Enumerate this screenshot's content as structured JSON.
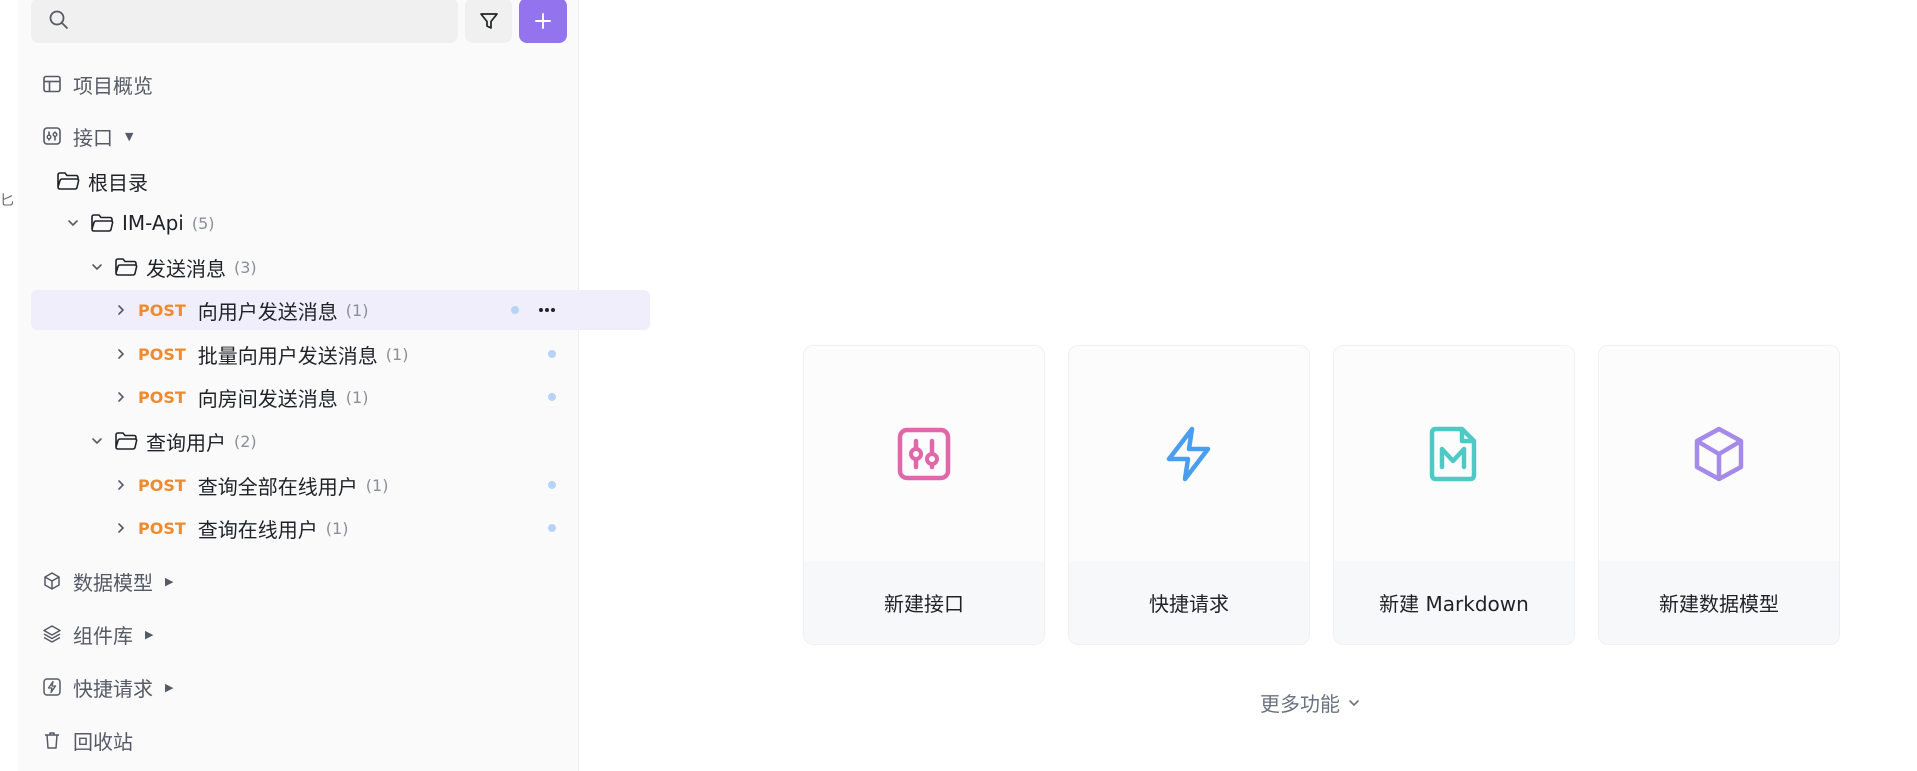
{
  "search": {
    "placeholder": "",
    "value": ""
  },
  "colors": {
    "accent": "#9373ee",
    "method_post": "#ee8b2e",
    "icon_pink": "#e067a9",
    "icon_blue": "#4a9eef",
    "icon_teal": "#4ec9c4",
    "icon_purple": "#a58ae9"
  },
  "gutter": {
    "glyph": "匕"
  },
  "nav": {
    "overview": "项目概览",
    "api": "接口",
    "data_models": "数据模型",
    "components": "组件库",
    "quick_request": "快捷请求",
    "recycle_bin": "回收站"
  },
  "tree": {
    "root": {
      "label": "根目录"
    },
    "im_api": {
      "label": "IM-Api",
      "count": "(5)"
    },
    "send_messages": {
      "label": "发送消息",
      "count": "(3)"
    },
    "query_users": {
      "label": "查询用户",
      "count": "(2)"
    },
    "endpoints": [
      {
        "method": "POST",
        "label": "向用户发送消息",
        "count": "(1)"
      },
      {
        "method": "POST",
        "label": "批量向用户发送消息",
        "count": "(1)"
      },
      {
        "method": "POST",
        "label": "向房间发送消息",
        "count": "(1)"
      },
      {
        "method": "POST",
        "label": "查询全部在线用户",
        "count": "(1)"
      },
      {
        "method": "POST",
        "label": "查询在线用户",
        "count": "(1)"
      }
    ]
  },
  "cards": [
    {
      "label": "新建接口",
      "icon": "api-icon"
    },
    {
      "label": "快捷请求",
      "icon": "lightning-icon"
    },
    {
      "label": "新建 Markdown",
      "icon": "markdown-icon"
    },
    {
      "label": "新建数据模型",
      "icon": "cube-icon"
    }
  ],
  "more_features": "更多功能"
}
